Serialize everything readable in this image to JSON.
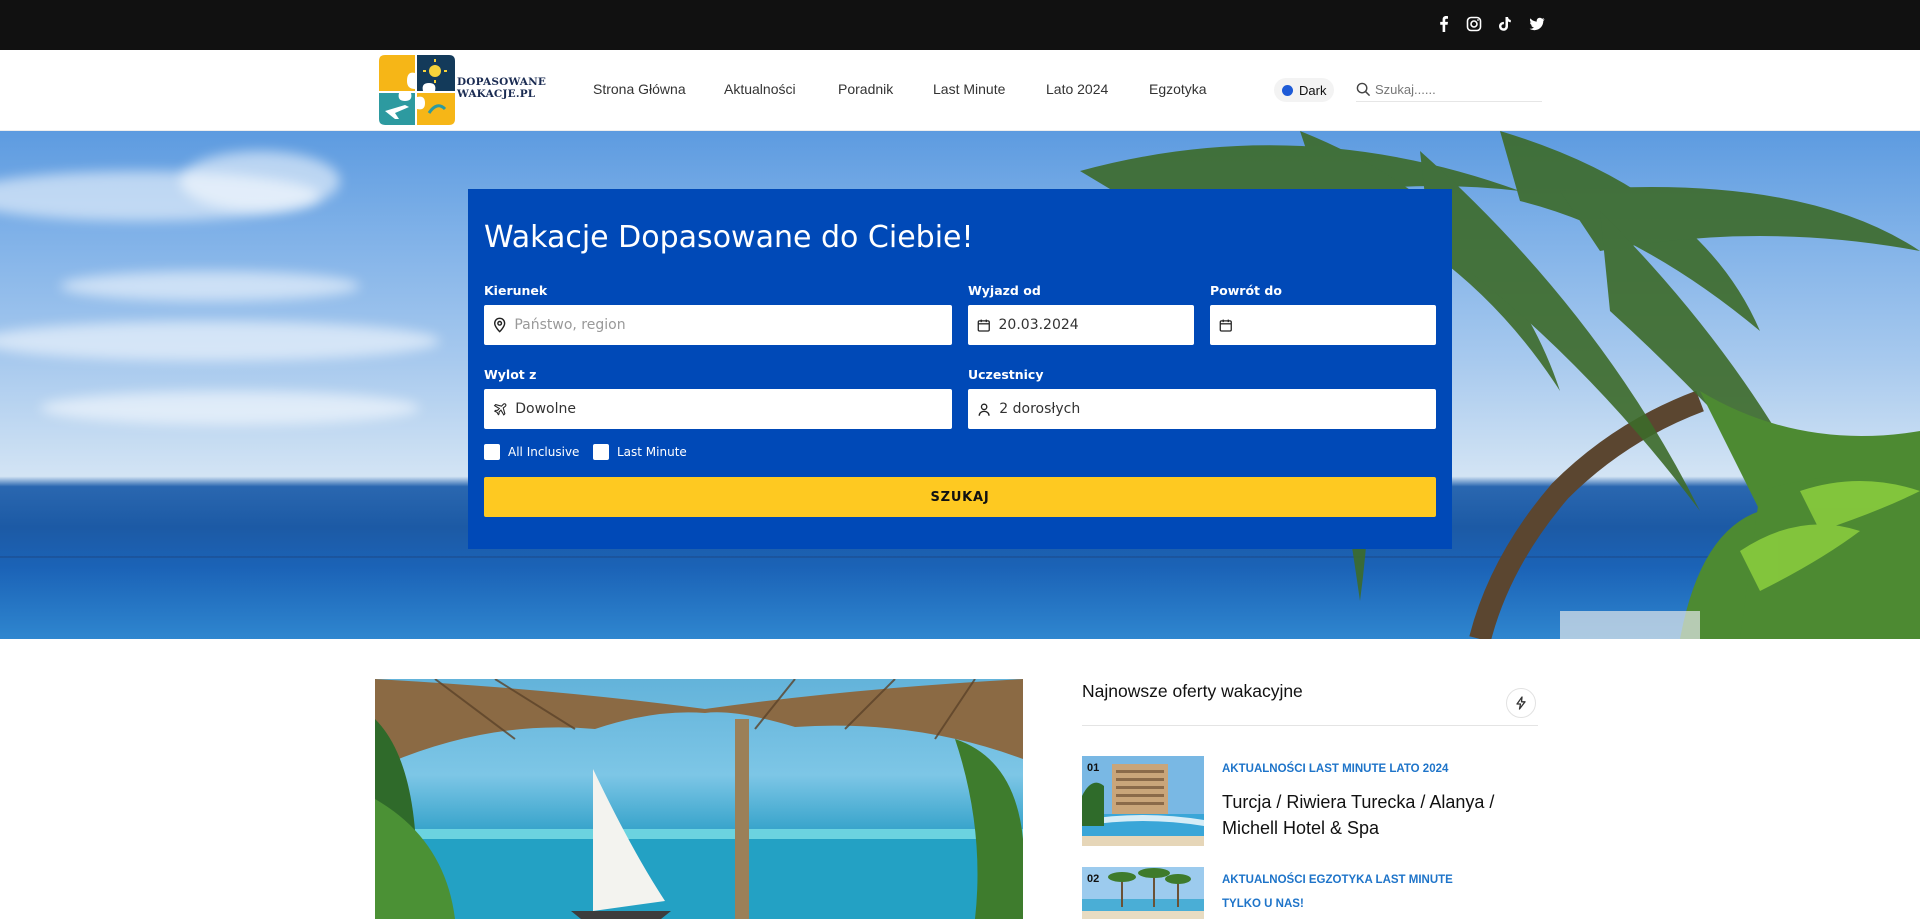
{
  "social": {
    "items": [
      {
        "name": "facebook-icon"
      },
      {
        "name": "instagram-icon"
      },
      {
        "name": "tiktok-icon"
      },
      {
        "name": "twitter-icon"
      }
    ]
  },
  "header": {
    "logo_line1": "DOPASOWANE",
    "logo_line2": "WAKACJE.PL",
    "nav": [
      {
        "label": "Strona Główna"
      },
      {
        "label": "Aktualności"
      },
      {
        "label": "Poradnik"
      },
      {
        "label": "Last Minute"
      },
      {
        "label": "Lato 2024"
      },
      {
        "label": "Egzotyka"
      }
    ],
    "dark_toggle_label": "Dark",
    "search_placeholder": "Szukaj......"
  },
  "search_form": {
    "title": "Wakacje Dopasowane do Ciebie!",
    "destination_label": "Kierunek",
    "destination_placeholder": "Państwo, region",
    "depart_label": "Wyjazd od",
    "depart_value": "20.03.2024",
    "return_label": "Powrót do",
    "return_value": "",
    "from_label": "Wylot z",
    "from_value": "Dowolne",
    "participants_label": "Uczestnicy",
    "participants_value": "2 dorosłych",
    "checkbox_all_inclusive": "All Inclusive",
    "checkbox_last_minute": "Last Minute",
    "submit_label": "SZUKAJ"
  },
  "sidebar": {
    "title": "Najnowsze oferty wakacyjne",
    "posts": [
      {
        "number": "01",
        "categories": "AKTUALNOŚCI LAST MINUTE LATO 2024",
        "title": "Turcja / Riwiera Turecka / Alanya / Michell Hotel & Spa"
      },
      {
        "number": "02",
        "categories": "AKTUALNOŚCI EGZOTYKA LAST MINUTE",
        "title": "TYLKO U NAS!"
      }
    ]
  },
  "colors": {
    "panel_blue": "#0049b7",
    "submit_yellow": "#fec921",
    "category_blue": "#1e74c9",
    "topbar_black": "#111111"
  }
}
